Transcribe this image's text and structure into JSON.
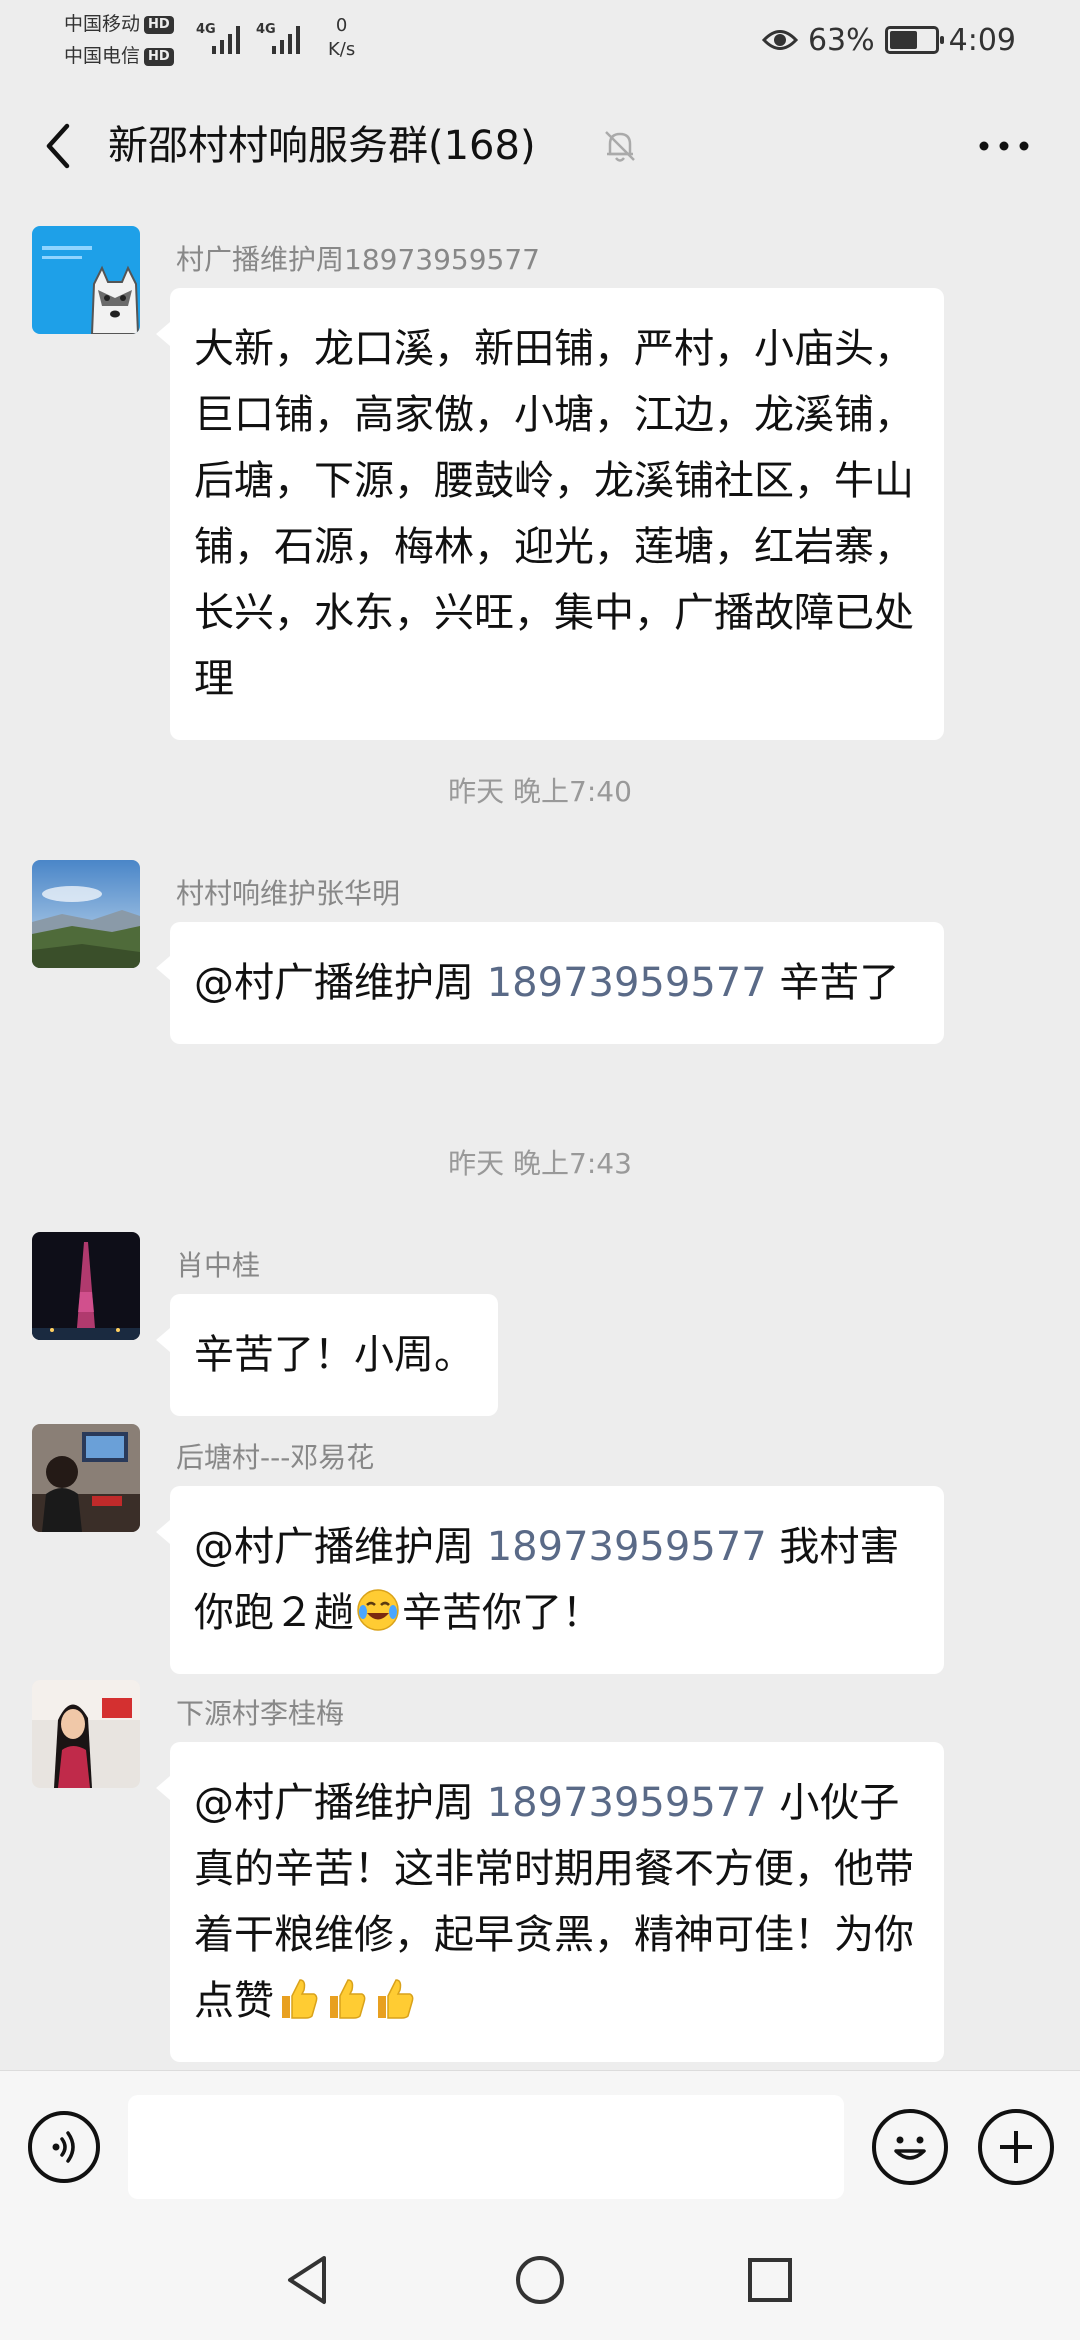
{
  "status_bar": {
    "carrier1": "中国移动",
    "carrier2": "中国电信",
    "hd_badge": "HD",
    "network1": "4G",
    "network2": "4G",
    "speed_value": "0",
    "speed_unit": "K/s",
    "battery": "63%",
    "battery_level": 0.63,
    "time": "4:09"
  },
  "header": {
    "title": "新邵村村响服务群(168)",
    "icons": {
      "back": "chevron-left-icon",
      "mute": "bell-off-icon",
      "more": "more-dots-icon"
    }
  },
  "messages": [
    {
      "sender": "村广播维护周18973959577",
      "text": "大新，龙口溪，新田铺，严村，小庙头，巨口铺，高家傲，小塘，江边，龙溪铺，后塘，下源，腰鼓岭，龙溪铺社区，牛山铺，石源，梅林，迎光，莲塘，红岩寨，长兴，水东，兴旺，集中，广播故障已处理"
    },
    {
      "timestamp": "昨天 晚上7:40"
    },
    {
      "sender": "村村响维护张华明",
      "mention": "@村广播维护周",
      "mention_number": "18973959577",
      "text": "辛苦了"
    },
    {
      "timestamp": "昨天 晚上7:43"
    },
    {
      "sender": "肖中桂",
      "text": "辛苦了！小周。"
    },
    {
      "sender": "后塘村---邓易花",
      "mention": "@村广播维护周",
      "mention_number": "18973959577",
      "text_before_emoji": "我村害你跑２趟",
      "text_after_emoji": "辛苦你了！"
    },
    {
      "sender": "下源村李桂梅",
      "mention": "@村广播维护周",
      "mention_number": "18973959577",
      "text": "小伙子真的辛苦！这非常时期用餐不方便，他带着干粮维修，起早贪黑，精神可佳！为你点赞"
    }
  ],
  "input_bar": {
    "placeholder": "",
    "icons": {
      "voice": "voice-icon",
      "emoji": "smiley-icon",
      "plus": "plus-icon"
    }
  },
  "nav_bar": {
    "icons": {
      "back": "triangle-back-icon",
      "home": "circle-home-icon",
      "recent": "square-recent-icon"
    }
  },
  "colors": {
    "background": "#ededed",
    "bubble": "#ffffff",
    "mention_number": "#5a6a87",
    "meta_text": "#888888"
  }
}
